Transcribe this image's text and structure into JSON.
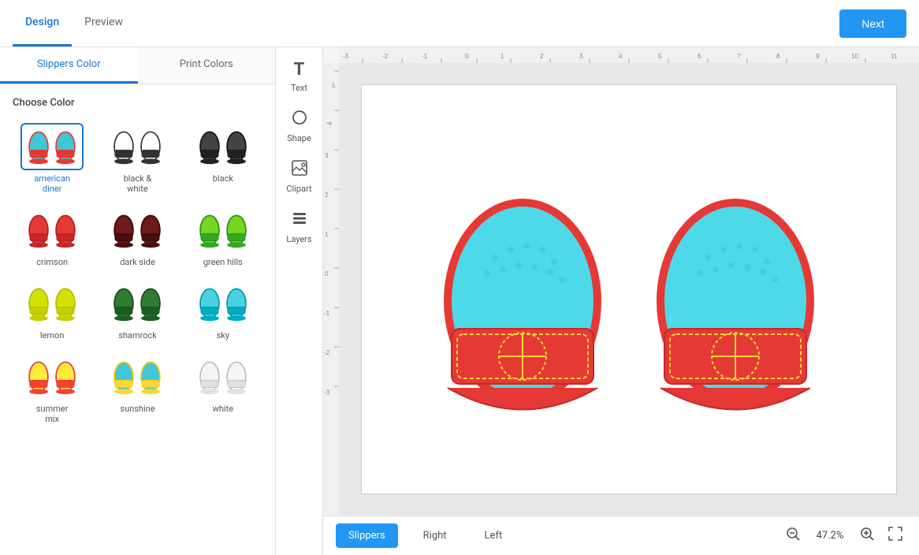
{
  "header": {
    "tabs": [
      {
        "id": "design",
        "label": "Design",
        "active": true
      },
      {
        "id": "preview",
        "label": "Preview",
        "active": false
      }
    ],
    "next_button": "Next"
  },
  "left_panel": {
    "tabs": [
      {
        "id": "slippers-color",
        "label": "Slippers Color",
        "active": true
      },
      {
        "id": "print-colors",
        "label": "Print Colors",
        "active": false
      }
    ],
    "section_title": "Choose Color",
    "colors": [
      {
        "id": "american-diner",
        "label": "american\ndiner",
        "selected": true,
        "sole": "#40c8d8",
        "strap": "#e53935",
        "outline": "#e53935"
      },
      {
        "id": "black-white",
        "label": "black &\nwhite",
        "selected": false,
        "sole": "#ffffff",
        "strap": "#333333",
        "outline": "#333333"
      },
      {
        "id": "black",
        "label": "black",
        "selected": false,
        "sole": "#444444",
        "strap": "#222222",
        "outline": "#111111"
      },
      {
        "id": "crimson",
        "label": "crimson",
        "selected": false,
        "sole": "#e53935",
        "strap": "#c62828",
        "outline": "#b71c1c"
      },
      {
        "id": "dark-side",
        "label": "dark side",
        "selected": false,
        "sole": "#6d1a1a",
        "strap": "#4a0e0e",
        "outline": "#3b0808"
      },
      {
        "id": "green-hills",
        "label": "green hills",
        "selected": false,
        "sole": "#76d620",
        "strap": "#33a821",
        "outline": "#2e8b1a"
      },
      {
        "id": "lemon",
        "label": "lemon",
        "selected": false,
        "sole": "#d4e000",
        "strap": "#c4d000",
        "outline": "#b0bc00"
      },
      {
        "id": "shamrock",
        "label": "shamrock",
        "selected": false,
        "sole": "#2e7d32",
        "strap": "#1b5e20",
        "outline": "#184d1c"
      },
      {
        "id": "sky",
        "label": "sky",
        "selected": false,
        "sole": "#4dd0e1",
        "strap": "#00acc1",
        "outline": "#0097a7"
      },
      {
        "id": "summer-mix",
        "label": "summer\nmix",
        "selected": false,
        "sole": "#ffeb3b",
        "strap": "#f44336",
        "outline": "#e53935"
      },
      {
        "id": "sunshine",
        "label": "sunshine",
        "selected": false,
        "sole": "#40c8d8",
        "strap": "#f9d835",
        "outline": "#f9c800"
      },
      {
        "id": "white",
        "label": "white",
        "selected": false,
        "sole": "#f5f5f5",
        "strap": "#e0e0e0",
        "outline": "#bdbdbd"
      }
    ]
  },
  "tools": [
    {
      "id": "text",
      "label": "Text",
      "icon": "T"
    },
    {
      "id": "shape",
      "label": "Shape",
      "icon": "◯"
    },
    {
      "id": "clipart",
      "label": "Clipart",
      "icon": "🖼"
    },
    {
      "id": "layers",
      "label": "Layers",
      "icon": "⊞"
    }
  ],
  "bottom_bar": {
    "view_tabs": [
      {
        "id": "slippers",
        "label": "Slippers",
        "active": true
      },
      {
        "id": "right",
        "label": "Right",
        "active": false
      },
      {
        "id": "left",
        "label": "Left",
        "active": false
      }
    ],
    "zoom": "47.2%"
  }
}
